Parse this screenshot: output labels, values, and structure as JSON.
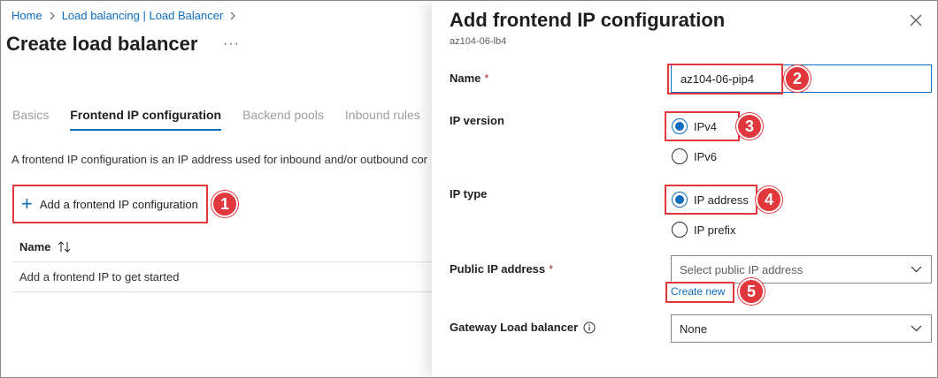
{
  "breadcrumb": {
    "home": "Home",
    "parent": "Load balancing | Load Balancer"
  },
  "page": {
    "title": "Create load balancer",
    "more": "···"
  },
  "tabs": [
    {
      "label": "Basics",
      "active": false
    },
    {
      "label": "Frontend IP configuration",
      "active": true
    },
    {
      "label": "Backend pools",
      "active": false
    },
    {
      "label": "Inbound rules",
      "active": false
    }
  ],
  "frontend": {
    "description": "A frontend IP configuration is an IP address used for inbound and/or outbound cor",
    "add_button": "Add a frontend IP configuration",
    "add_icon": "+",
    "table": {
      "columns": [
        "Name"
      ],
      "empty_text": "Add a frontend IP to get started"
    }
  },
  "panel": {
    "title": "Add frontend IP configuration",
    "subtitle": "az104-06-lb4",
    "fields": {
      "name": {
        "label": "Name",
        "required": "*",
        "value": "az104-06-pip4"
      },
      "ip_version": {
        "label": "IP version",
        "options": [
          "IPv4",
          "IPv6"
        ],
        "selected": "IPv4"
      },
      "ip_type": {
        "label": "IP type",
        "options": [
          "IP address",
          "IP prefix"
        ],
        "selected": "IP address"
      },
      "public_ip": {
        "label": "Public IP address",
        "required": "*",
        "placeholder": "Select public IP address",
        "create_link": "Create new"
      },
      "gateway_lb": {
        "label": "Gateway Load balancer",
        "value": "None"
      }
    }
  },
  "callouts": [
    "1",
    "2",
    "3",
    "4",
    "5"
  ],
  "icons": {
    "close": "close-icon",
    "chevron": "chevron-down-icon",
    "sort": "sort-icon",
    "info": "info-icon",
    "breadcrumb_sep": "chevron-right-icon",
    "add": "plus-icon"
  },
  "colors": {
    "accent": "#0f6cbd",
    "callout": "#e0383c",
    "required": "#a4262c"
  }
}
